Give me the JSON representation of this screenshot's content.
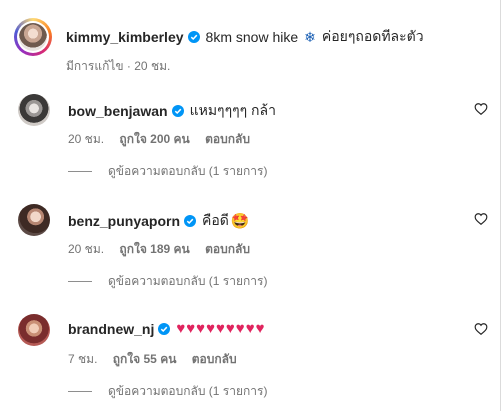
{
  "caption": {
    "username": "kimmy_kimberley",
    "text": "8km snow hike",
    "snow_glyph": "❄",
    "text_after": "ค่อยๆถอดทีละตัว",
    "meta": "มีการแก้ไข · 20 ชม."
  },
  "comments": [
    {
      "username": "bow_benjawan",
      "text": "แหมๆๆๆๆ กล้า",
      "time": "20 ชม.",
      "likes": "ถูกใจ 200 คน",
      "reply": "ตอบกลับ",
      "view_replies": "ดูข้อความตอบกลับ (1 รายการ)"
    },
    {
      "username": "benz_punyaporn",
      "text": "คือดี",
      "emoji": "🤩",
      "time": "20 ชม.",
      "likes": "ถูกใจ 189 คน",
      "reply": "ตอบกลับ",
      "view_replies": "ดูข้อความตอบกลับ (1 รายการ)"
    },
    {
      "username": "brandnew_nj",
      "text": "♥♥♥♥♥♥♥♥♥",
      "time": "7 ชม.",
      "likes": "ถูกใจ 55 คน",
      "reply": "ตอบกลับ",
      "view_replies": "ดูข้อความตอบกลับ (1 รายการ)"
    }
  ],
  "colors": {
    "verified": "#0095f6",
    "heart": "#e0245e",
    "muted": "#737373"
  },
  "icons": {
    "verified": "verified-badge-icon",
    "like": "heart-outline-icon",
    "snowflake": "snowflake-icon"
  }
}
